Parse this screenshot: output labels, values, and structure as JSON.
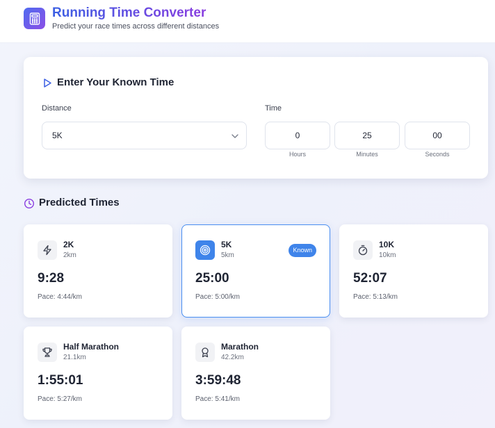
{
  "app": {
    "title": "Running Time Converter",
    "subtitle": "Predict your race times across different distances",
    "logo_icon": "calculator-icon"
  },
  "input": {
    "title": "Enter Your Known Time",
    "title_icon": "play-icon",
    "distance_label": "Distance",
    "distance_value": "5K",
    "time_label": "Time",
    "hours": "0",
    "minutes": "25",
    "seconds": "00",
    "hours_caption": "Hours",
    "minutes_caption": "Minutes",
    "seconds_caption": "Seconds"
  },
  "predicted": {
    "title": "Predicted Times",
    "title_icon": "clock-icon",
    "known_badge": "Known",
    "cards": [
      {
        "name": "2K",
        "distance": "2km",
        "time": "9:28",
        "pace": "Pace: 4:44/km",
        "icon": "lightning-icon"
      },
      {
        "name": "5K",
        "distance": "5km",
        "time": "25:00",
        "pace": "Pace: 5:00/km",
        "icon": "target-icon",
        "known": true
      },
      {
        "name": "10K",
        "distance": "10km",
        "time": "52:07",
        "pace": "Pace: 5:13/km",
        "icon": "stopwatch-icon"
      },
      {
        "name": "Half Marathon",
        "distance": "21.1km",
        "time": "1:55:01",
        "pace": "Pace: 5:27/km",
        "icon": "trophy-icon"
      },
      {
        "name": "Marathon",
        "distance": "42.2km",
        "time": "3:59:48",
        "pace": "Pace: 5:41/km",
        "icon": "medal-icon"
      }
    ]
  },
  "colors": {
    "accent_blue": "#3f84ea",
    "title_gradient_start": "#3b5fe3",
    "title_gradient_end": "#8a3ee0",
    "clock_icon": "#8a3ee0",
    "play_icon": "#3b5fe3"
  }
}
